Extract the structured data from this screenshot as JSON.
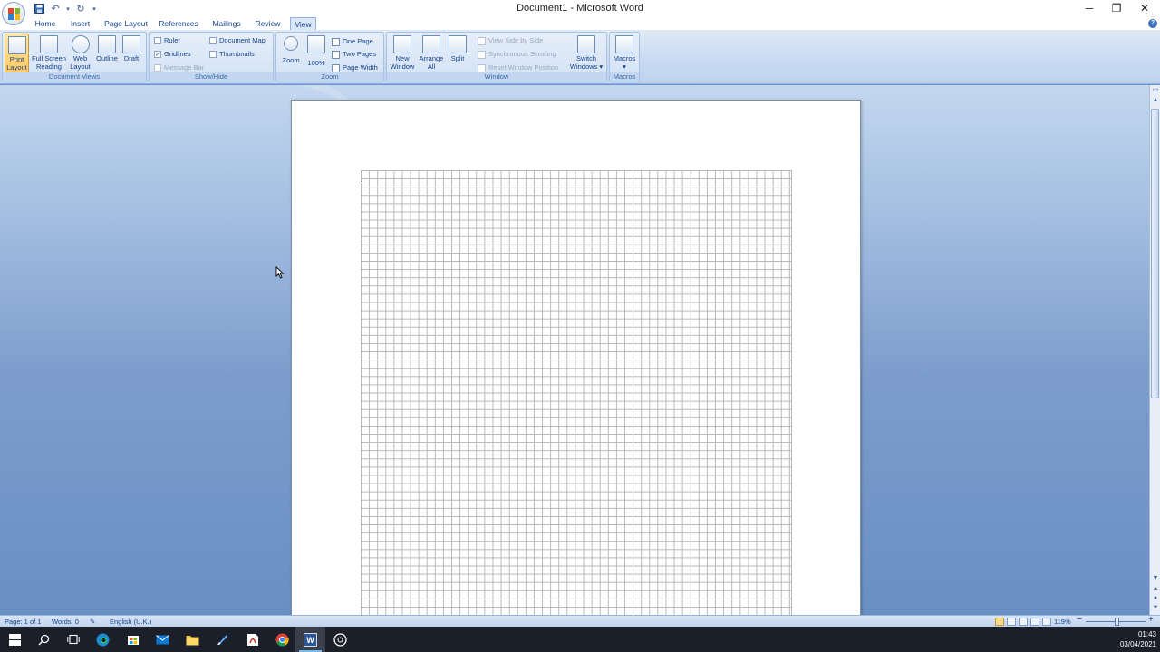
{
  "window": {
    "title": "Document1 - Microsoft Word",
    "minimize": "─",
    "restore": "❐",
    "close": "✕"
  },
  "tabs": [
    {
      "label": "Home",
      "active": false
    },
    {
      "label": "Insert",
      "active": false
    },
    {
      "label": "Page Layout",
      "active": false
    },
    {
      "label": "References",
      "active": false
    },
    {
      "label": "Mailings",
      "active": false
    },
    {
      "label": "Review",
      "active": false
    },
    {
      "label": "View",
      "active": true
    }
  ],
  "ribbon": {
    "document_views": {
      "label": "Document Views",
      "buttons": [
        {
          "line1": "Print",
          "line2": "Layout",
          "active": true
        },
        {
          "line1": "Full Screen",
          "line2": "Reading",
          "active": false
        },
        {
          "line1": "Web",
          "line2": "Layout",
          "active": false
        },
        {
          "line1": "Outline",
          "line2": "",
          "active": false
        },
        {
          "line1": "Draft",
          "line2": "",
          "active": false
        }
      ]
    },
    "show_hide": {
      "label": "Show/Hide",
      "ruler": {
        "label": "Ruler",
        "checked": false
      },
      "gridlines": {
        "label": "Gridlines",
        "checked": true,
        "mark": "✓"
      },
      "message_bar": {
        "label": "Message Bar",
        "checked": false
      },
      "document_map": {
        "label": "Document Map",
        "checked": false
      },
      "thumbnails": {
        "label": "Thumbnails",
        "checked": false
      }
    },
    "zoom": {
      "label": "Zoom",
      "zoom_btn": "Zoom",
      "hundred_btn": "100%",
      "one_page": "One Page",
      "two_pages": "Two Pages",
      "page_width": "Page Width"
    },
    "window_group": {
      "label": "Window",
      "new_window": {
        "line1": "New",
        "line2": "Window"
      },
      "arrange_all": {
        "line1": "Arrange",
        "line2": "All"
      },
      "split": {
        "line1": "Split",
        "line2": ""
      },
      "view_side_by_side": "View Side by Side",
      "synchronous_scrolling": "Synchronous Scrolling",
      "reset_window_position": "Reset Window Position",
      "switch_windows": {
        "line1": "Switch",
        "line2": "Windows ▾"
      }
    },
    "macros": {
      "label": "Macros",
      "button": {
        "line1": "Macros",
        "line2": "▾"
      }
    }
  },
  "statusbar": {
    "page": "Page: 1 of 1",
    "words": "Words: 0",
    "language": "English (U.K.)",
    "zoom": "119%",
    "zoom_out": "−",
    "zoom_in": "+"
  },
  "taskbar": {
    "time": "01:43",
    "date": "03/04/2021"
  },
  "colors": {
    "ribbon_text": "#15428b",
    "active_button": "#ffc862",
    "taskbar": "#1b1f2a"
  }
}
